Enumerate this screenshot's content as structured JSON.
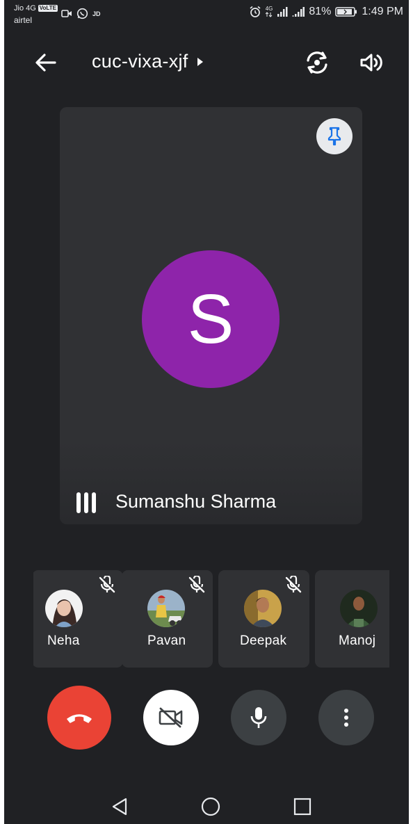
{
  "status_bar": {
    "carrier_primary": "Jio 4G",
    "volte_badge": "VoLTE",
    "carrier_secondary": "airtel",
    "notif_jd": "JD",
    "lte_top": "4G",
    "battery_percent": "81%",
    "time": "1:49 PM"
  },
  "topbar": {
    "meeting_code": "cuc-vixa-xjf"
  },
  "main_tile": {
    "avatar_initial": "S",
    "avatar_color": "#8e24aa",
    "participant_name": "Sumanshu Sharma"
  },
  "participants": [
    {
      "name": "Neha",
      "muted": true
    },
    {
      "name": "Pavan",
      "muted": true
    },
    {
      "name": "Deepak",
      "muted": true
    },
    {
      "name": "Manoj",
      "muted": true
    }
  ],
  "colors": {
    "background": "#202124",
    "tile": "#303134",
    "end_call": "#ea4335",
    "control": "#3c4043",
    "pin_accent": "#1a73e8"
  },
  "icons": {
    "back": "arrow-left-icon",
    "title_chevron": "triangle-right-icon",
    "switch_camera": "switch-camera-icon",
    "speaker": "speaker-icon",
    "pin": "pin-icon",
    "mute": "mic-off-icon",
    "end_call": "phone-hangup-icon",
    "video": "video-off-icon",
    "mic": "mic-icon",
    "more": "more-vert-icon"
  }
}
